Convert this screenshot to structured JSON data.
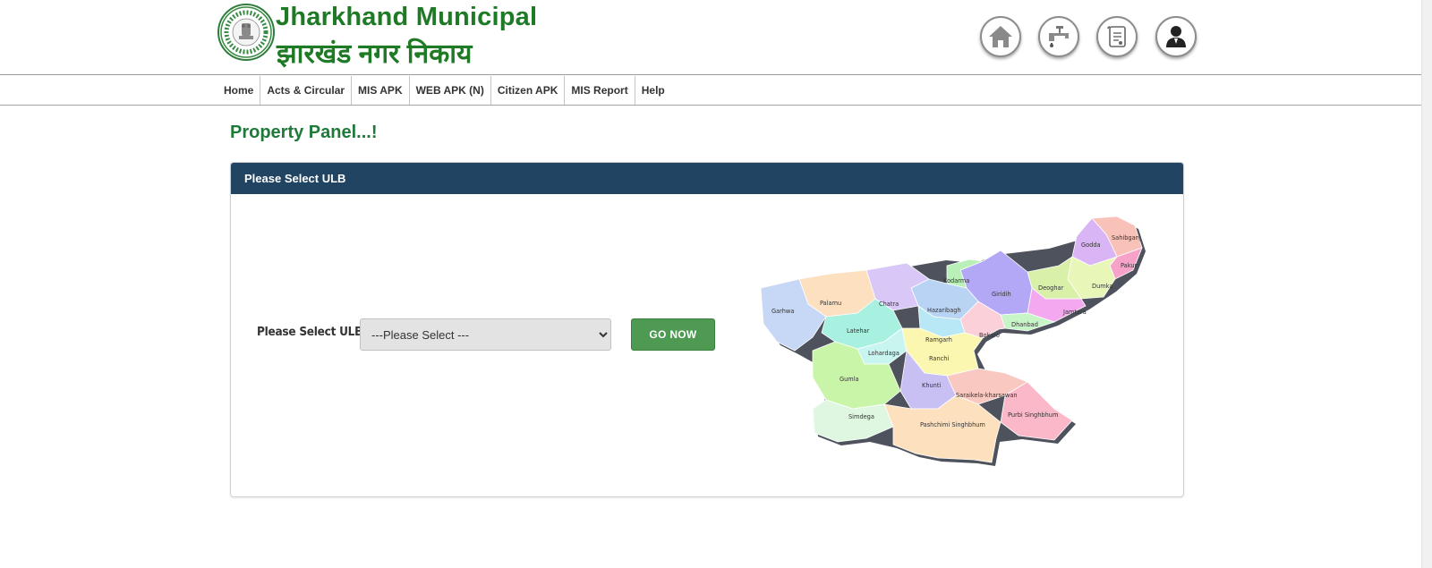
{
  "brand": {
    "title_en": "Jharkhand Municipal",
    "title_hi": "झारखंड नगर निकाय"
  },
  "header_icons": [
    "home-icon",
    "water-tap-icon",
    "document-icon",
    "user-icon"
  ],
  "nav": {
    "items": [
      {
        "label": "Home"
      },
      {
        "label": "Acts & Circular"
      },
      {
        "label": "MIS APK"
      },
      {
        "label": "WEB APK (N)"
      },
      {
        "label": "Citizen APK"
      },
      {
        "label": "MIS Report"
      },
      {
        "label": "Help"
      }
    ]
  },
  "page": {
    "title": "Property Panel...!"
  },
  "panel": {
    "heading": "Please Select ULB",
    "ulb_label": "Please Select ULB",
    "select_value": "---Please Select ---",
    "go_button": "GO NOW"
  },
  "map": {
    "districts": [
      "Godda",
      "Sahibganj",
      "Pakur",
      "Kodarma",
      "Giridih",
      "Deoghar",
      "Dumka",
      "Garhwa",
      "Palamu",
      "Chatra",
      "Hazaribagh",
      "Jamtara",
      "Latehar",
      "Dhanbad",
      "Ramgarh",
      "Bokaro",
      "Lohardaga",
      "Ranchi",
      "Gumla",
      "Khunti",
      "Saraikela-kharsawan",
      "Purbi Singhbhum",
      "Simdega",
      "Pashchimi Singhbhum"
    ]
  },
  "colors": {
    "brand_green": "#1e7a24",
    "panel_header": "#204461",
    "go_button": "#4e9a52"
  }
}
